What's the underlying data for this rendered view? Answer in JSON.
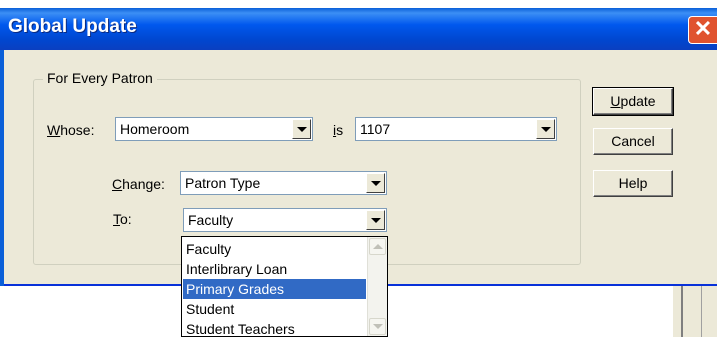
{
  "dialog": {
    "title": "Global Update",
    "close_glyph": "✕",
    "group_title": "For Every Patron",
    "whose_label_key": "W",
    "whose_label_rest": "hose:",
    "whose_value": "Homeroom",
    "is_label_key": "i",
    "is_label_rest": "s",
    "is_value": "1107",
    "change_label_key": "C",
    "change_label_rest": "hange:",
    "change_value": "Patron Type",
    "to_label_key": "T",
    "to_label_rest": "o:",
    "to_value": "Faculty",
    "buttons": {
      "update_key": "U",
      "update_rest": "pdate",
      "cancel": "Cancel",
      "help": "Help"
    },
    "to_options": [
      "Faculty",
      "Interlibrary Loan",
      "Primary Grades",
      "Student",
      "Student Teachers"
    ],
    "selected_option": "Primary Grades"
  }
}
